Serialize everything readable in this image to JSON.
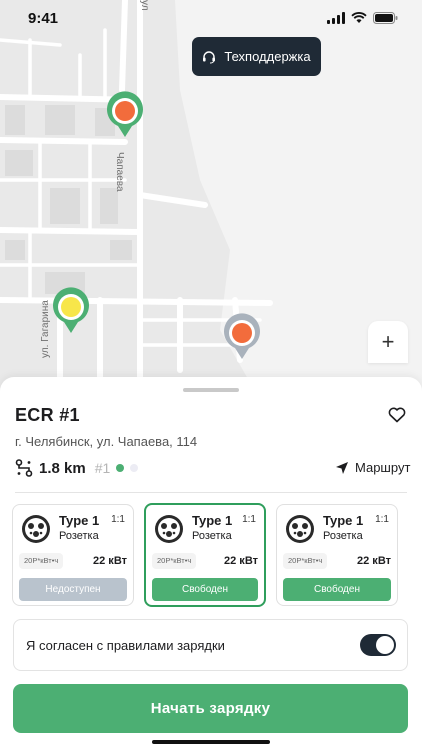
{
  "status_bar": {
    "time": "9:41"
  },
  "support": {
    "label": "Техподдержка"
  },
  "map": {
    "streets": {
      "chapaeva": "Чапаева",
      "gagarina": "ул. Гагарина",
      "top": "ул"
    },
    "markers": [
      {
        "name": "marker-green-orange",
        "ring": "#4caf73",
        "center": "#f26c3c"
      },
      {
        "name": "marker-green-yellow",
        "ring": "#4caf73",
        "center": "#f7e64a"
      },
      {
        "name": "marker-grey-orange",
        "ring": "#a9b2bc",
        "center": "#f26c3c"
      }
    ],
    "zoom_label": "+"
  },
  "station": {
    "name": "ECR #1",
    "address": "г. Челябинск, ул. Чапаева, 114",
    "distance": "1.8 km",
    "number": "#1",
    "route_label": "Маршрут"
  },
  "connectors": [
    {
      "type": "Type 1",
      "sub": "Розетка",
      "ratio": "1:1",
      "price": "20Р*кВт•ч",
      "power": "22 кВт",
      "status": "Недоступен",
      "state": "busy"
    },
    {
      "type": "Type 1",
      "sub": "Розетка",
      "ratio": "1:1",
      "price": "20Р*кВт•ч",
      "power": "22 кВт",
      "status": "Свободен",
      "state": "free"
    },
    {
      "type": "Type 1",
      "sub": "Розетка",
      "ratio": "1:1",
      "price": "20Р*кВт•ч",
      "power": "22 кВт",
      "status": "Свободен",
      "state": "free"
    }
  ],
  "agreement": {
    "label": "Я согласен с правилами зарядки",
    "checked": true
  },
  "start_button": {
    "label": "Начать зарядку"
  },
  "colors": {
    "accent": "#4caf73",
    "dark": "#1f2a36",
    "disabled": "#b9c3cd"
  }
}
